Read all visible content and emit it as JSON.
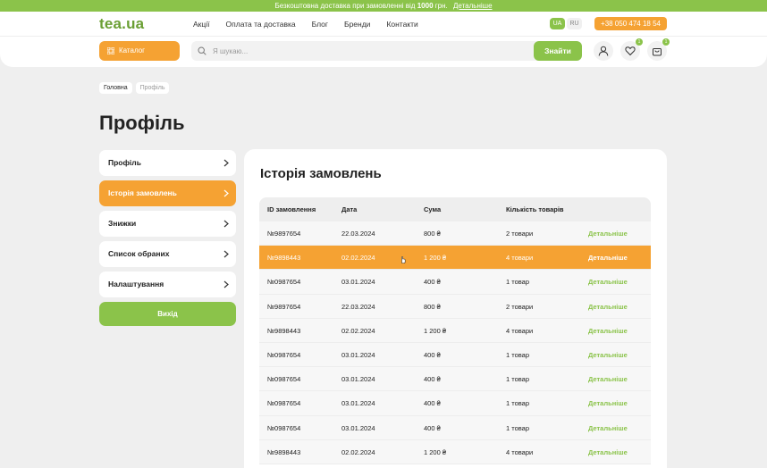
{
  "promo": {
    "text": "Безкоштовна доставка при замовленні від",
    "amount": "1000",
    "currency": "грн.",
    "link": "Детальніше"
  },
  "header": {
    "logo": "tea.ua",
    "nav": [
      "Акції",
      "Оплата та доставка",
      "Блог",
      "Бренди",
      "Контакти"
    ],
    "lang": {
      "active": "UA",
      "inactive": "RU"
    },
    "phone": "+38 050 474 18 54",
    "catalog": "Каталог",
    "search": {
      "placeholder": "Я шукаю...",
      "button": "Знайти"
    },
    "badges": {
      "wishlist": "1",
      "cart": "1"
    }
  },
  "breadcrumb": {
    "home": "Головна",
    "current": "Профіль"
  },
  "page_title": "Профіль",
  "sidebar": {
    "items": [
      {
        "label": "Профіль",
        "active": false
      },
      {
        "label": "Історія замовлень",
        "active": true
      },
      {
        "label": "Знижки",
        "active": false
      },
      {
        "label": "Список обраних",
        "active": false
      },
      {
        "label": "Налаштування",
        "active": false
      }
    ],
    "logout": "Вихід"
  },
  "orders": {
    "title": "Історія замовлень",
    "columns": [
      "ID замовлення",
      "Дата",
      "Сума",
      "Кількість товарів"
    ],
    "details_label": "Детальніше",
    "rows": [
      {
        "id": "№9897654",
        "date": "22.03.2024",
        "sum": "800 ₴",
        "qty": "2 товари"
      },
      {
        "id": "№9898443",
        "date": "02.02.2024",
        "sum": "1 200 ₴",
        "qty": "4 товари"
      },
      {
        "id": "№0987654",
        "date": "03.01.2024",
        "sum": "400 ₴",
        "qty": "1 товар"
      },
      {
        "id": "№9897654",
        "date": "22.03.2024",
        "sum": "800 ₴",
        "qty": "2 товари"
      },
      {
        "id": "№9898443",
        "date": "02.02.2024",
        "sum": "1 200 ₴",
        "qty": "4 товари"
      },
      {
        "id": "№0987654",
        "date": "03.01.2024",
        "sum": "400 ₴",
        "qty": "1 товар"
      },
      {
        "id": "№0987654",
        "date": "03.01.2024",
        "sum": "400 ₴",
        "qty": "1 товар"
      },
      {
        "id": "№0987654",
        "date": "03.01.2024",
        "sum": "400 ₴",
        "qty": "1 товар"
      },
      {
        "id": "№0987654",
        "date": "03.01.2024",
        "sum": "400 ₴",
        "qty": "1 товар"
      },
      {
        "id": "№9898443",
        "date": "02.02.2024",
        "sum": "1 200 ₴",
        "qty": "4 товари"
      }
    ]
  },
  "colors": {
    "green": "#8bc34a",
    "orange": "#f5a233",
    "bg": "#efefef"
  }
}
